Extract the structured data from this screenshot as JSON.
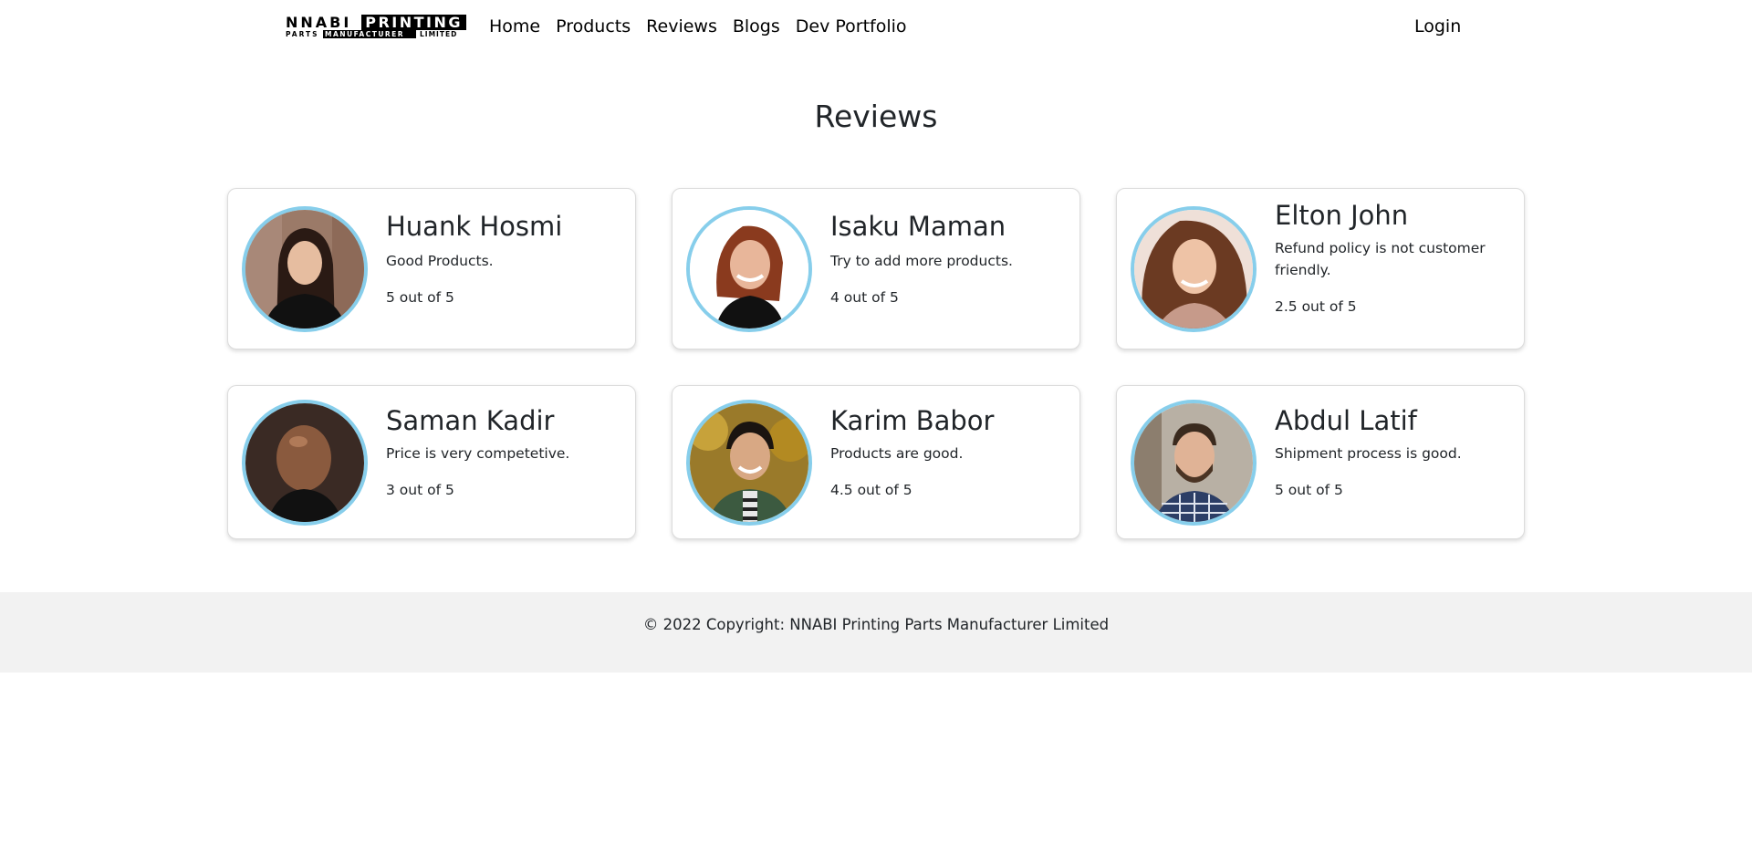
{
  "brand": {
    "word1": "NNABI",
    "word2": "PRINTING",
    "word3": "PARTS",
    "word4": "MANUFACTURER",
    "word5": "LIMITED"
  },
  "nav": {
    "items": [
      {
        "label": "Home"
      },
      {
        "label": "Products"
      },
      {
        "label": "Reviews"
      },
      {
        "label": "Blogs"
      },
      {
        "label": "Dev Portfolio"
      }
    ],
    "login_label": "Login"
  },
  "page": {
    "title": "Reviews"
  },
  "reviews": [
    {
      "name": "Huank Hosmi",
      "text": "Good Products.",
      "rating": "5 out of 5",
      "avatar_icon": "woman-brunette-photo"
    },
    {
      "name": "Isaku Maman",
      "text": "Try to add more products.",
      "rating": "4 out of 5",
      "avatar_icon": "woman-redhead-photo"
    },
    {
      "name": "Elton John",
      "text": "Refund policy is not customer friendly.",
      "rating": "2.5 out of 5",
      "avatar_icon": "woman-curly-hair-photo"
    },
    {
      "name": "Saman Kadir",
      "text": "Price is very competetive.",
      "rating": "3 out of 5",
      "avatar_icon": "man-bald-photo"
    },
    {
      "name": "Karim Babor",
      "text": "Products are good.",
      "rating": "4.5 out of 5",
      "avatar_icon": "man-smiling-photo"
    },
    {
      "name": "Abdul Latif",
      "text": "Shipment process is good.",
      "rating": "5 out of 5",
      "avatar_icon": "man-beard-photo"
    }
  ],
  "colors": {
    "avatar_border": "#87ceeb",
    "footer_bg": "#f2f2f2"
  },
  "footer": {
    "copyright": "© 2022 Copyright: NNABI Printing Parts Manufacturer Limited"
  }
}
